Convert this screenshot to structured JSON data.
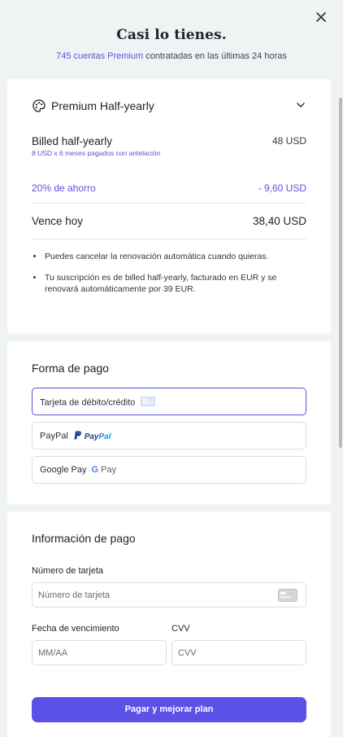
{
  "header": {
    "title": "Casi lo tienes.",
    "subtitle_accent": "745 cuentas Premium",
    "subtitle_rest": " contratadas en las últimas 24 horas"
  },
  "plan": {
    "name": "Premium Half-yearly",
    "billed_label": "Billed half-yearly",
    "billed_amount": "48 USD",
    "billed_detail": "8 USD x 6 meses pagados con antelación",
    "savings_label": "20% de ahorro",
    "savings_amount": "- 9,60 USD",
    "due_label": "Vence hoy",
    "due_amount": "38,40 USD",
    "notes": [
      "Puedes cancelar la renovación automática cuando quieras.",
      "Tu suscripción es de billed half-yearly, facturado en EUR y se renovará automáticamente por 39 EUR."
    ]
  },
  "payment_method": {
    "title": "Forma de pago",
    "options": [
      {
        "label": "Tarjeta de débito/crédito",
        "icon": "credit-card-icon",
        "selected": true
      },
      {
        "label": "PayPal",
        "logo_part1": "Pay",
        "logo_part2": "Pal",
        "icon": "paypal-logo"
      },
      {
        "label": "Google Pay",
        "logo_g": "G",
        "logo_pay": "Pay",
        "icon": "google-pay-logo"
      }
    ]
  },
  "payment_info": {
    "title": "Información de pago",
    "card_number_label": "Número de tarjeta",
    "card_number_placeholder": "Número de tarjeta",
    "expiry_label": "Fecha de vencimiento",
    "expiry_placeholder": "MM/AA",
    "cvv_label": "CVV",
    "cvv_placeholder": "CVV",
    "submit_label": "Pagar y mejorar plan"
  },
  "colors": {
    "accent": "#5b51d8",
    "button": "#5b51e6",
    "background": "#f0f3f4"
  }
}
